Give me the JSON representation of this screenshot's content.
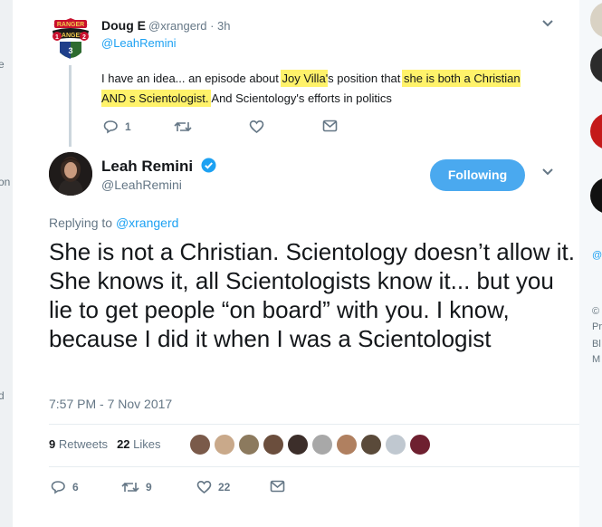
{
  "edge_left": [
    "e",
    "on",
    "d"
  ],
  "edge_right": [
    "@",
    "©",
    "Pr",
    "Bl",
    "M"
  ],
  "parent_tweet": {
    "name": "Doug E",
    "handle": "@xrangerd",
    "time": "3h",
    "handle_time": "@xrangerd · 3h",
    "replying_to": "@LeahRemini",
    "text_parts": [
      "I have an idea... an episode about ",
      "Joy Villa",
      "'s position that ",
      "she is both a Christian AND s Scientologist.",
      " And Scientology's efforts in politics"
    ],
    "reply_count": "1",
    "avatar_lettering": [
      "RANGER",
      "RANGER",
      "1",
      "2",
      "3"
    ]
  },
  "main_tweet": {
    "name": "Leah Remini",
    "handle": "@LeahRemini",
    "follow_label": "Following",
    "replying_label": "Replying to",
    "replying_handle": "@xrangerd",
    "text": "She is not a Christian. Scientology doesn’t allow it. She knows it, all Scientologists know it... but you lie to get people “on board” with you. I know, because I did it when I was a Scientologist",
    "timestamp": "7:57 PM - 7 Nov 2017",
    "retweets_count": "9",
    "retweets_label": "Retweets",
    "likes_count": "22",
    "likes_label": "Likes",
    "reply_count": "6",
    "retweet_count_action": "9",
    "like_count_action": "22"
  },
  "liker_colors": [
    "#7a5a4a",
    "#c9a98a",
    "#8c7a5e",
    "#6b4e3d",
    "#3c2e2a",
    "#a8a8a8",
    "#b08060",
    "#5a4a3a",
    "#c0c8d0",
    "#6e2030"
  ],
  "colors": {
    "accent": "#1da1f2",
    "follow_button": "#4aa9ef",
    "highlight": "#fff26a",
    "muted": "#657786"
  }
}
